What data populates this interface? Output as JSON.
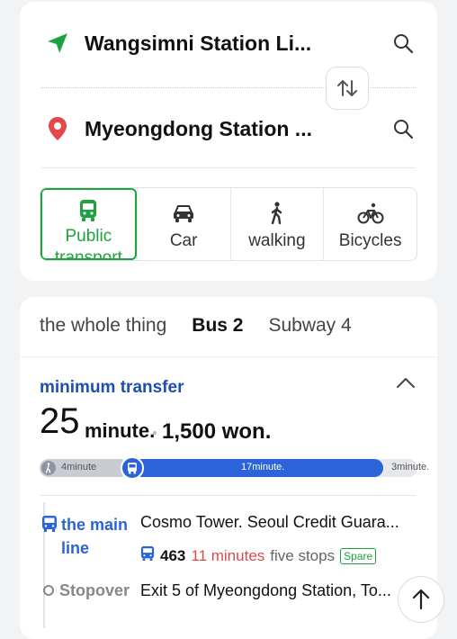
{
  "route": {
    "origin": "Wangsimni Station Li...",
    "destination": "Myeongdong Station ...",
    "modes": [
      {
        "label": "Public transport",
        "icon": "bus-icon",
        "active": true
      },
      {
        "label": "Car",
        "icon": "car-icon",
        "active": false
      },
      {
        "label": "walking",
        "icon": "walking-icon",
        "active": false
      },
      {
        "label": "Bicycles",
        "icon": "bicycle-icon",
        "active": false
      }
    ]
  },
  "tabs": [
    {
      "label": "the whole thing"
    },
    {
      "label": "Bus 2"
    },
    {
      "label": "Subway 4"
    }
  ],
  "summary": {
    "title": "minimum transfer",
    "duration_value": "25",
    "duration_unit": "minute.",
    "price": "1,500 won."
  },
  "timeline": {
    "walk1": "4minute",
    "bus": "17minute.",
    "walk2": "3minute."
  },
  "steps": {
    "main_label": "the main line",
    "main_place": "Cosmo Tower. Seoul Credit Guara...",
    "bus_number": "463",
    "bus_time": "11 minutes",
    "bus_stops": "five stops",
    "bus_badge": "Spare",
    "stop_label": "Stopover",
    "stop_place": "Exit 5 of Myeongdong Station, To..."
  },
  "colors": {
    "accent_green": "#1ea23f",
    "bus_blue": "#2b63d8",
    "time_red": "#d94b4b"
  }
}
